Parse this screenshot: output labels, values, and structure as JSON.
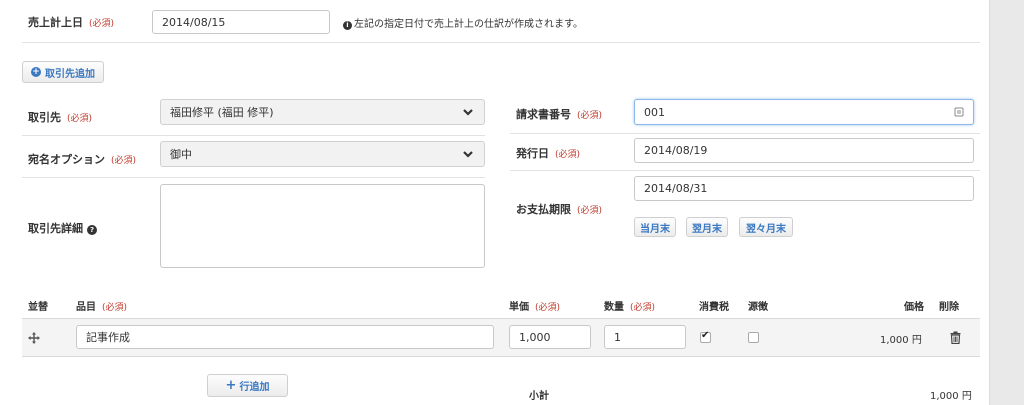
{
  "sales_date": {
    "label": "売上計上日",
    "required": "(必須)",
    "value": "2014/08/15",
    "note": "左記の指定日付で売上計上の仕訳が作成されます。"
  },
  "add_client_button": "取引先追加",
  "client": {
    "label": "取引先",
    "required": "(必須)",
    "value": "福田修平 (福田 修平)"
  },
  "honorific": {
    "label": "宛名オプション",
    "required": "(必須)",
    "value": "御中"
  },
  "client_detail": {
    "label": "取引先詳細",
    "value": ""
  },
  "invoice_number": {
    "label": "請求書番号",
    "required": "(必須)",
    "value": "001"
  },
  "issue_date": {
    "label": "発行日",
    "required": "(必須)",
    "value": "2014/08/19"
  },
  "due_date": {
    "label": "お支払期限",
    "required": "(必須)",
    "value": "2014/08/31",
    "shortcuts": [
      "当月末",
      "翌月末",
      "翌々月末"
    ]
  },
  "table": {
    "headers": {
      "reorder": "並替",
      "item": "品目",
      "item_required": "(必須)",
      "unit_price": "単価",
      "unit_price_required": "(必須)",
      "quantity": "数量",
      "quantity_required": "(必須)",
      "tax": "消費税",
      "withholding": "源徴",
      "price": "価格",
      "delete": "削除"
    },
    "rows": [
      {
        "item": "記事作成",
        "unit_price": "1,000",
        "quantity": "1",
        "tax": true,
        "withholding": false,
        "price": "1,000",
        "currency": "円"
      }
    ]
  },
  "add_row_button": "行追加",
  "subtotal": {
    "label": "小計",
    "value": "1,000",
    "currency": "円"
  },
  "icons": {
    "move": "move-icon",
    "trash": "trash-icon",
    "info": "info-icon",
    "question": "question-icon",
    "chevron": "chevron-down-icon",
    "plus": "plus-icon"
  },
  "colors": {
    "accent": "#3a78c2",
    "required": "#c0392b"
  }
}
